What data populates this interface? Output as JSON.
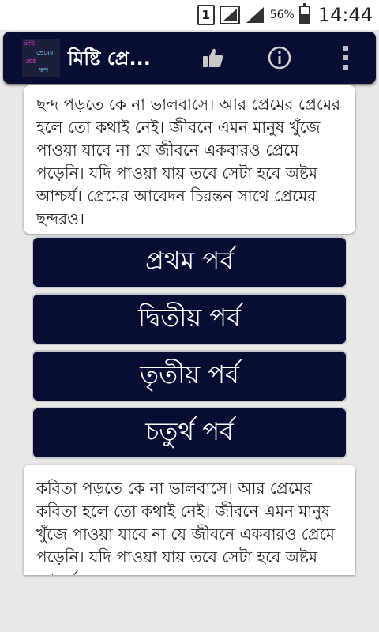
{
  "status_bar": {
    "sim_slot": "1",
    "battery_text": "56%",
    "battery_level": 0.56,
    "time": "14:44"
  },
  "toolbar": {
    "logo_lines": [
      "মিষ্টি",
      "প্রেমের",
      "শ্রেষ্ঠ",
      "ছন্দ"
    ],
    "title": "মিষ্টি প্রে...",
    "icons": [
      "thumbs-up-icon",
      "info-icon",
      "overflow-menu-icon"
    ]
  },
  "intro_card": {
    "text": "ছন্দ পড়তে কে না ভালবাসে। আর প্রেমের প্রেমের হলে তো কথাই নেই। জীবনে এমন মানুষ খুঁজে পাওয়া যাবে না যে জীবনে একবারও প্রেমে পড়েনি। যদি পাওয়া যায় তবে সেটা হবে অষ্টম আশ্চর্য। প্রেমের আবেদন চিরন্তন সাথে প্রেমের ছন্দরও।"
  },
  "episodes": [
    {
      "label": "প্রথম পর্ব"
    },
    {
      "label": "দ্বিতীয় পর্ব"
    },
    {
      "label": "তৃতীয় পর্ব"
    },
    {
      "label": "চতুর্থ পর্ব"
    }
  ],
  "bottom_card": {
    "text": "কবিতা পড়তে কে না ভালবাসে। আর প্রেমের কবিতা হলে তো কথাই নেই। জীবনে এমন মানুষ খুঁজে পাওয়া যাবে না যে জীবনে একবারও প্রেমে পড়েনি। যদি পাওয়া যায় তবে সেটা হবে অষ্টম আশ্চর্য।"
  },
  "colors": {
    "toolbar_bg": "#070d33",
    "page_bg": "#e8e8e6",
    "logo_pink": "#e040c0",
    "logo_cyan": "#7fd7ff"
  }
}
